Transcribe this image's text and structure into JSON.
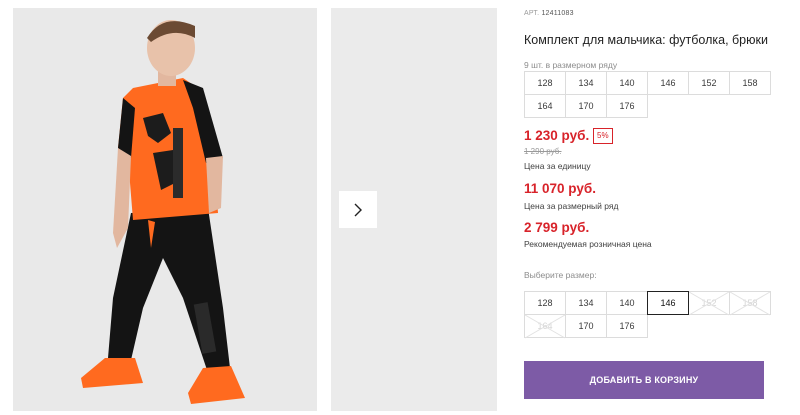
{
  "product": {
    "art_label": "АРТ.",
    "art_value": "12411083",
    "title": "Комплект для мальчика: футболка, брюки",
    "row_count": "9 шт. в размерном ряду",
    "row_sizes": [
      "128",
      "134",
      "140",
      "146",
      "152",
      "158",
      "164",
      "170",
      "176"
    ]
  },
  "prices": {
    "unit_price": "1 230 руб.",
    "discount": "5%",
    "old_price": "1 290 руб.",
    "unit_label": "Цена за единицу",
    "row_price": "11 070 руб.",
    "row_label": "Цена за размерный ряд",
    "rrp_price": "2 799 руб.",
    "rrp_label": "Рекомендуемая розничная цена"
  },
  "size_picker": {
    "label": "Выберите размер:",
    "sizes": [
      {
        "value": "128",
        "state": "available"
      },
      {
        "value": "134",
        "state": "available"
      },
      {
        "value": "140",
        "state": "available"
      },
      {
        "value": "146",
        "state": "selected"
      },
      {
        "value": "152",
        "state": "disabled"
      },
      {
        "value": "158",
        "state": "disabled"
      },
      {
        "value": "164",
        "state": "disabled"
      },
      {
        "value": "170",
        "state": "available"
      },
      {
        "value": "176",
        "state": "available"
      }
    ]
  },
  "cart": {
    "add_label": "ДОБАВИТЬ В КОРЗИНУ"
  },
  "colors": {
    "accent_red": "#d8232a",
    "button_purple": "#7d5ba6",
    "shirt_orange": "#ff6a1f"
  },
  "icons": {
    "gallery_next": "chevron-right-icon"
  }
}
